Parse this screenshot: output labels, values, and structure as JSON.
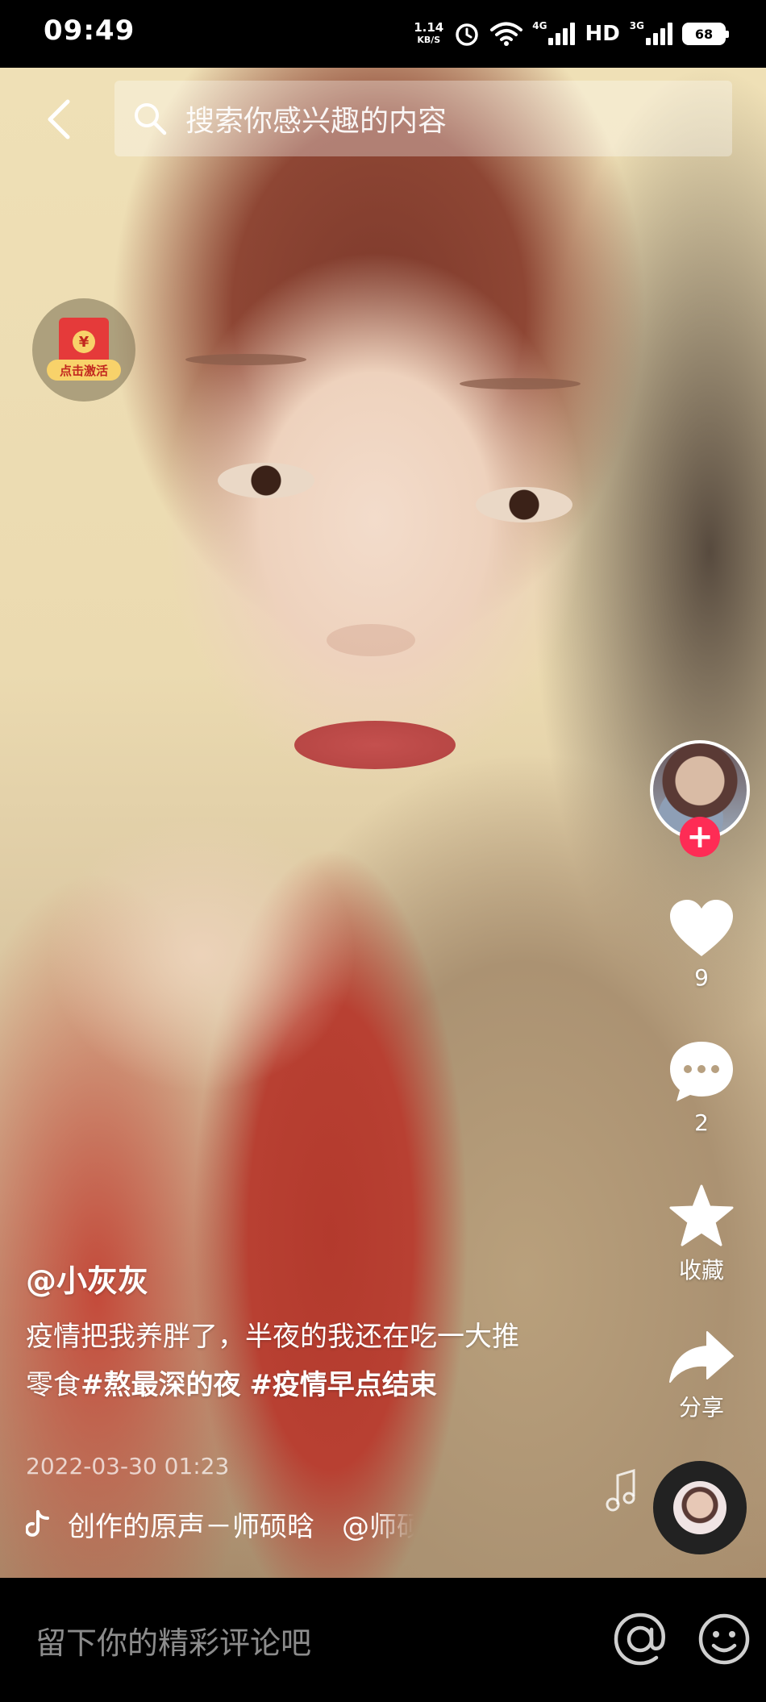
{
  "status_bar": {
    "time": "09:49",
    "net_speed_value": "1.14",
    "net_speed_unit": "KB/S",
    "network_4g": "4G",
    "hd": "HD",
    "network_3g": "3G",
    "battery": "68",
    "icons": [
      "alarm-icon",
      "wifi-icon",
      "signal-4g-icon",
      "signal-3g-icon",
      "battery-icon"
    ]
  },
  "top_bar": {
    "back_icon": "back-arrow-icon",
    "search_icon": "search-icon",
    "search_placeholder": "搜索你感兴趣的内容"
  },
  "red_envelope": {
    "label": "点击激活",
    "coin": "¥"
  },
  "actions": {
    "follow": "+",
    "likes_count": "9",
    "comments_count": "2",
    "favorite_label": "收藏",
    "share_label": "分享"
  },
  "post": {
    "author": "@小灰灰",
    "caption_text": "疫情把我养胖了，半夜的我还在吃一大推零食",
    "hashtag_1": "#熬最深的夜",
    "hashtag_2": "#疫情早点结束",
    "date": "2022-03-30 01:23",
    "music": "创作的原声－师硕晗　@师硕晗"
  },
  "comment_bar": {
    "placeholder": "留下你的精彩评论吧",
    "at_icon": "at-icon",
    "emoji_icon": "emoji-icon"
  },
  "colors": {
    "accent": "#fe2c55",
    "background": "#000000",
    "envelope": "#e53a3a"
  }
}
